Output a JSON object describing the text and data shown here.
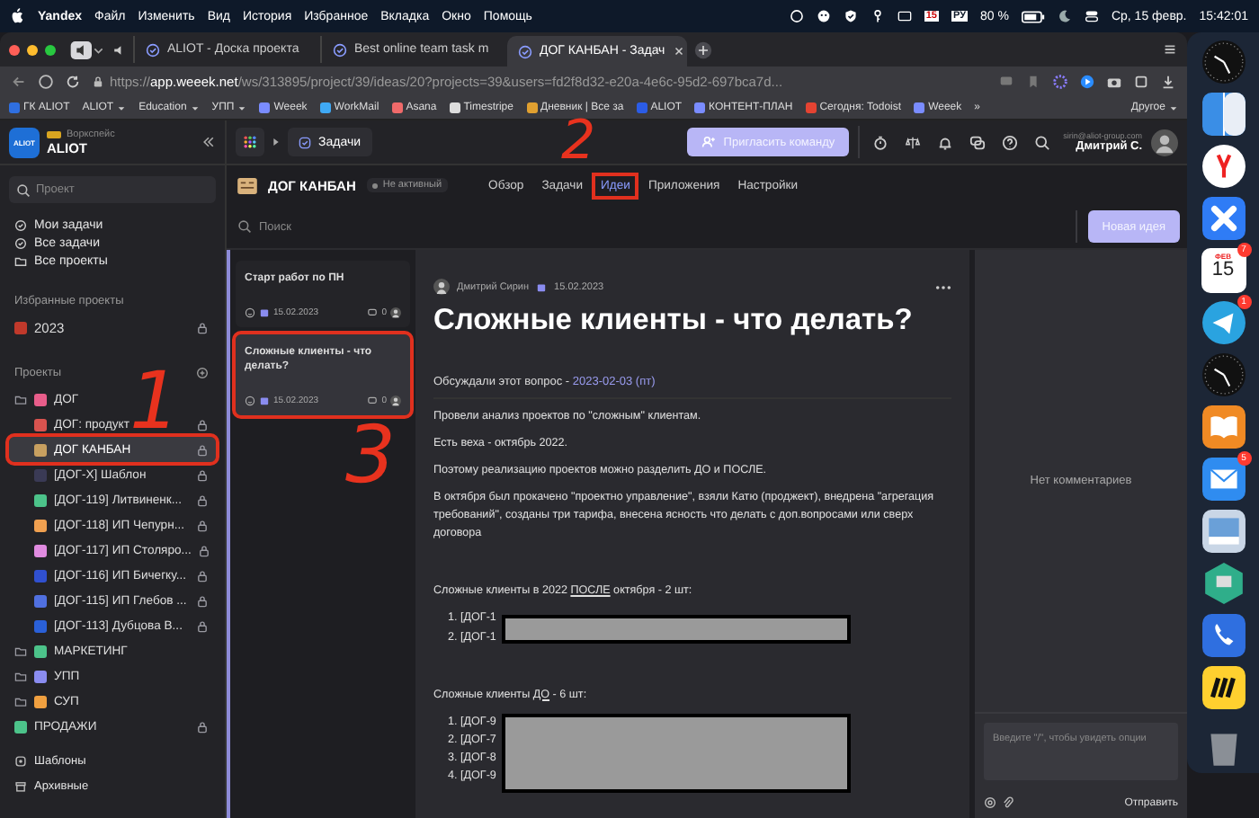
{
  "menu_bar": {
    "app": "Yandex",
    "items": [
      "Файл",
      "Изменить",
      "Вид",
      "История",
      "Избранное",
      "Вкладка",
      "Окно",
      "Помощь"
    ],
    "calendar_day": "15",
    "keyboard": "РУ",
    "battery": "80 %",
    "date": "Ср, 15 февр.",
    "time": "15:42:01"
  },
  "browser": {
    "tabs": [
      {
        "title": "ALIOT - Доска проекта",
        "selected": false
      },
      {
        "title": "Best online team task m",
        "selected": false
      },
      {
        "title": "ДОГ КАНБАН - Задач",
        "selected": true
      }
    ],
    "url": {
      "scheme": "https://",
      "host": "app.weeek.net",
      "path": "/ws/313895/project/39/ideas/20?projects=39&users=fd2f8d32-e20a-4e6c-95d2-697bca7d..."
    },
    "bookmarks": [
      {
        "label": "ГК ALIOT",
        "kind": "link",
        "color": "#2f6fe0"
      },
      {
        "label": "ALIOT",
        "kind": "folder"
      },
      {
        "label": "Education",
        "kind": "folder"
      },
      {
        "label": "УПП",
        "kind": "folder"
      },
      {
        "label": "Weeek",
        "kind": "link",
        "color": "#7a8cff"
      },
      {
        "label": "WorkMail",
        "kind": "link",
        "color": "#3fa9f5"
      },
      {
        "label": "Asana",
        "kind": "link",
        "color": "#f06a6a"
      },
      {
        "label": "Timestripe",
        "kind": "link",
        "color": "#dddddd"
      },
      {
        "label": "Дневник | Все за",
        "kind": "link",
        "color": "#e0a030"
      },
      {
        "label": "ALIOT",
        "kind": "link",
        "color": "#2b5ce6"
      },
      {
        "label": "КОНТЕНТ-ПЛАН",
        "kind": "link",
        "color": "#7a8cff"
      },
      {
        "label": "Сегодня: Todoist",
        "kind": "link",
        "color": "#e44332"
      },
      {
        "label": "Weeek",
        "kind": "link",
        "color": "#7a8cff"
      }
    ],
    "more": "»",
    "other": "Другое"
  },
  "workspace": {
    "logo": "ALIOT",
    "label": "Воркспейс",
    "name": "ALIOT"
  },
  "top_bar": {
    "section": "Задачи",
    "invite_button": "Пригласить команду",
    "email": "sirin@aliot-group.com",
    "user": "Дмитрий С."
  },
  "sidebar": {
    "search_placeholder": "Проект",
    "nav": [
      {
        "label": "Мои задачи",
        "kind": "tasks"
      },
      {
        "label": "Все задачи",
        "kind": "tasks"
      },
      {
        "label": "Все проекты",
        "kind": "projects"
      }
    ],
    "favorites_title": "Избранные проекты",
    "favorites": [
      {
        "label": "2023",
        "color": "#c0392b",
        "locked": true
      }
    ],
    "projects_title": "Проекты",
    "projects": [
      {
        "label": "ДОГ",
        "kind": "folder",
        "color": "#e85d8a",
        "locked": false,
        "selected": false,
        "highlighted": false,
        "children": [
          {
            "label": "ДОГ: продукт",
            "kind": "project",
            "color": "#d9534f",
            "locked": true,
            "selected": false,
            "highlighted": false
          },
          {
            "label": "ДОГ КАНБАН",
            "kind": "project",
            "color": "#c8a060",
            "locked": true,
            "selected": true,
            "highlighted": true
          },
          {
            "label": "[ДОГ-X] Шаблон",
            "kind": "project",
            "color": "#3a3a55",
            "locked": true,
            "selected": false,
            "highlighted": false
          },
          {
            "label": "[ДОГ-119] Литвиненк...",
            "kind": "project",
            "color": "#4cc38a",
            "locked": true,
            "selected": false,
            "highlighted": false
          },
          {
            "label": "[ДОГ-118] ИП Чепурн...",
            "kind": "project",
            "color": "#f0a050",
            "locked": true,
            "selected": false,
            "highlighted": false
          },
          {
            "label": "[ДОГ-117] ИП Столяро...",
            "kind": "project",
            "color": "#e08be0",
            "locked": true,
            "selected": false,
            "highlighted": false
          },
          {
            "label": "[ДОГ-116] ИП Бичегку...",
            "kind": "project",
            "color": "#3050d0",
            "locked": true,
            "selected": false,
            "highlighted": false
          },
          {
            "label": "[ДОГ-115] ИП Глебов ...",
            "kind": "project",
            "color": "#5070e0",
            "locked": true,
            "selected": false,
            "highlighted": false
          },
          {
            "label": "[ДОГ-113] Дубцова В...",
            "kind": "project",
            "color": "#2a60d8",
            "locked": true,
            "selected": false,
            "highlighted": false
          }
        ]
      },
      {
        "label": "МАРКЕТИНГ",
        "kind": "folder",
        "color": "#4cc38a",
        "locked": false,
        "selected": false,
        "highlighted": false
      },
      {
        "label": "УПП",
        "kind": "folder",
        "color": "#8a8cf0",
        "locked": false,
        "selected": false,
        "highlighted": false
      },
      {
        "label": "СУП",
        "kind": "folder",
        "color": "#f0a040",
        "locked": false,
        "selected": false,
        "highlighted": false
      },
      {
        "label": "ПРОДАЖИ",
        "kind": "project",
        "color": "#4cc38a",
        "locked": true,
        "selected": false,
        "highlighted": false
      }
    ],
    "footer": [
      {
        "label": "Шаблоны",
        "kind": "templates"
      },
      {
        "label": "Архивные",
        "kind": "archive"
      }
    ]
  },
  "project": {
    "name": "ДОГ КАНБАН",
    "status": "Не активный",
    "tabs": [
      {
        "label": "Обзор",
        "selected": false,
        "highlighted": false
      },
      {
        "label": "Задачи",
        "selected": false,
        "highlighted": false
      },
      {
        "label": "Идеи",
        "selected": true,
        "highlighted": true
      },
      {
        "label": "Приложения",
        "selected": false,
        "highlighted": false
      },
      {
        "label": "Настройки",
        "selected": false,
        "highlighted": false
      }
    ],
    "search_placeholder": "Поиск",
    "new_button": "Новая идея"
  },
  "ideas": [
    {
      "title": "Старт работ по ПН",
      "date": "15.02.2023",
      "comments": "0",
      "selected": false,
      "highlighted": false
    },
    {
      "title": "Сложные клиенты - что делать?",
      "date": "15.02.2023",
      "comments": "0",
      "selected": true,
      "highlighted": true
    }
  ],
  "idea": {
    "author": "Дмитрий Сирин",
    "date": "15.02.2023",
    "title": "Сложные клиенты - что делать?",
    "discussed_label": "Обсуждали этот вопрос - ",
    "discussed_date": "2023-02-03 (пт)",
    "paragraphs": [
      "Провели анализ проектов по \"сложным\" клиентам.",
      "Есть веха -  октябрь 2022.",
      "Поэтому реализацию проектов можно разделить ДО и ПОСЛЕ.",
      "В октября был прокачено \"проектно управление\", взяли Катю (проджект), внедрена \"агрегация требований\", созданы три тарифа, внесена ясность что делать с доп.вопросами или сверх договора"
    ],
    "sections": [
      {
        "heading": [
          {
            "text": "Сложные клиенты в 2022 ",
            "underline": false
          },
          {
            "text": "ПОСЛЕ",
            "underline": true
          },
          {
            "text": " октября - 2 шт:",
            "underline": false
          }
        ],
        "redacted": true,
        "items": [
          {
            "number": "1.",
            "text": "[ДОГ-1"
          },
          {
            "number": "2.",
            "text": "[ДОГ-1"
          }
        ]
      },
      {
        "heading": [
          {
            "text": "Сложные клиенты ",
            "underline": false
          },
          {
            "text": "ДО",
            "underline": true
          },
          {
            "text": " - 6 шт:",
            "underline": false
          }
        ],
        "redacted": true,
        "items": [
          {
            "number": "1.",
            "text": "[ДОГ-9"
          },
          {
            "number": "2.",
            "text": "[ДОГ-7"
          },
          {
            "number": "3.",
            "text": "[ДОГ-8"
          },
          {
            "number": "4.",
            "text": "[ДОГ-9"
          }
        ]
      }
    ]
  },
  "comments": {
    "empty": "Нет комментариев",
    "placeholder": "Введите \"/\", чтобы увидеть опции",
    "send": "Отправить"
  },
  "dock": [
    {
      "kind": "clock"
    },
    {
      "kind": "finder"
    },
    {
      "kind": "yandex"
    },
    {
      "kind": "cross"
    },
    {
      "kind": "calendar",
      "month": "ФЕВ",
      "day": "15",
      "badge": "7"
    },
    {
      "kind": "telegram",
      "badge": "1"
    },
    {
      "kind": "clock"
    },
    {
      "kind": "books"
    },
    {
      "kind": "mail",
      "badge": "5"
    },
    {
      "kind": "photos"
    },
    {
      "kind": "hex"
    },
    {
      "kind": "phone"
    },
    {
      "kind": "miro"
    },
    {
      "kind": "trash"
    }
  ],
  "annotations": [
    {
      "label": "1"
    },
    {
      "label": "2"
    },
    {
      "label": "3"
    }
  ]
}
